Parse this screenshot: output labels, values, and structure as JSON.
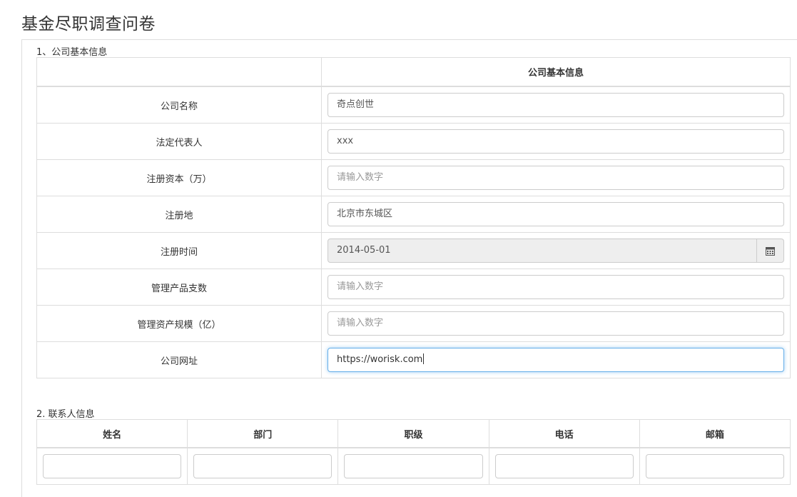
{
  "page": {
    "title": "基金尽职调查问卷"
  },
  "section1": {
    "label": "1、公司基本信息",
    "header_right": "公司基本信息",
    "rows": [
      {
        "label": "公司名称",
        "value": "奇点创世",
        "placeholder": ""
      },
      {
        "label": "法定代表人",
        "value": "xxx",
        "placeholder": ""
      },
      {
        "label": "注册资本（万）",
        "value": "",
        "placeholder": "请输入数字"
      },
      {
        "label": "注册地",
        "value": "北京市东城区",
        "placeholder": ""
      },
      {
        "label": "注册时间",
        "value": "2014-05-01",
        "placeholder": ""
      },
      {
        "label": "管理产品支数",
        "value": "",
        "placeholder": "请输入数字"
      },
      {
        "label": "管理资产规模（亿）",
        "value": "",
        "placeholder": "请输入数字"
      },
      {
        "label": "公司网址",
        "value": "https://worisk.com",
        "placeholder": ""
      }
    ],
    "date_icon": "calendar-icon"
  },
  "section2": {
    "label": "2. 联系人信息",
    "columns": [
      "姓名",
      "部门",
      "职级",
      "电话",
      "邮箱"
    ]
  },
  "colors": {
    "border": "#dddddd",
    "focus": "#66afe9",
    "readonly_bg": "#eeeeee",
    "placeholder": "#999999"
  }
}
